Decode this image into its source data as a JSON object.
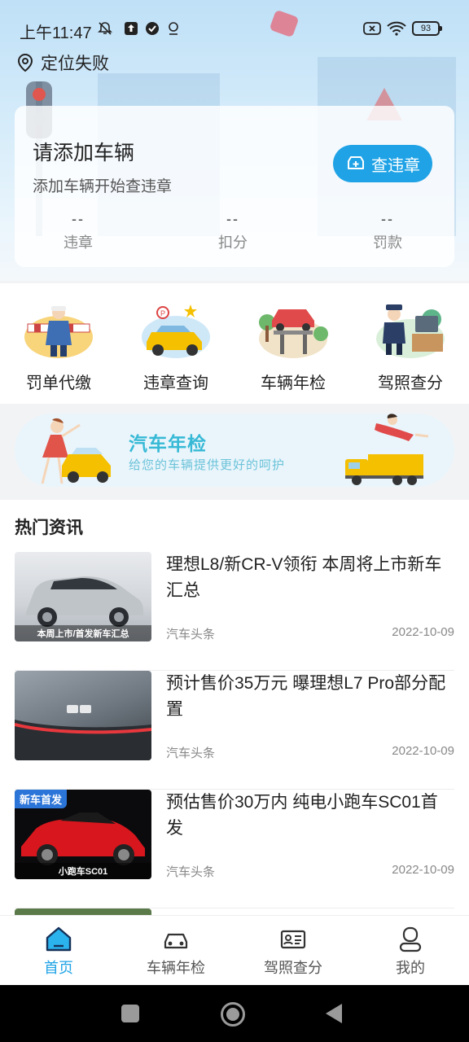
{
  "status_bar": {
    "time": "上午11:47",
    "battery": "93",
    "icons": [
      "notification-muted-icon",
      "upload-icon",
      "check-badge-icon",
      "location-pin-icon",
      "sim-x-icon",
      "wifi-icon",
      "battery-icon"
    ]
  },
  "location": {
    "icon": "location-pin-icon",
    "text": "定位失败"
  },
  "vehicle_card": {
    "title": "请添加车辆",
    "subtitle": "添加车辆开始查违章",
    "button_label": "查违章",
    "stats": [
      {
        "value": "--",
        "label": "违章"
      },
      {
        "value": "--",
        "label": "扣分"
      },
      {
        "value": "--",
        "label": "罚款"
      }
    ]
  },
  "services": [
    {
      "label": "罚单代缴",
      "icon": "ticket-payment-icon"
    },
    {
      "label": "违章查询",
      "icon": "violation-query-icon"
    },
    {
      "label": "车辆年检",
      "icon": "vehicle-inspection-icon"
    },
    {
      "label": "驾照查分",
      "icon": "license-points-icon"
    }
  ],
  "banner": {
    "title": "汽车年检",
    "subtitle": "给您的车辆提供更好的呵护"
  },
  "news": {
    "header": "热门资讯",
    "items": [
      {
        "title": "理想L8/新CR-V领衔 本周将上市新车汇总",
        "source": "汽车头条",
        "date": "2022-10-09",
        "thumb_caption": "本周上市/首发新车汇总",
        "thumb_tag": ""
      },
      {
        "title": "预计售价35万元 曝理想L7 Pro部分配置",
        "source": "汽车头条",
        "date": "2022-10-09",
        "thumb_caption": "",
        "thumb_tag": ""
      },
      {
        "title": "预估售价30万内 纯电小跑车SC01首发",
        "source": "汽车头条",
        "date": "2022-10-09",
        "thumb_caption": "小跑车SC01",
        "thumb_tag": "新车首发"
      }
    ]
  },
  "tabs": [
    {
      "label": "首页",
      "icon": "home-icon",
      "active": true
    },
    {
      "label": "车辆年检",
      "icon": "car-icon",
      "active": false
    },
    {
      "label": "驾照查分",
      "icon": "id-card-icon",
      "active": false
    },
    {
      "label": "我的",
      "icon": "profile-icon",
      "active": false
    }
  ],
  "colors": {
    "accent": "#1fa3e6",
    "banner_title": "#37b9d6"
  }
}
